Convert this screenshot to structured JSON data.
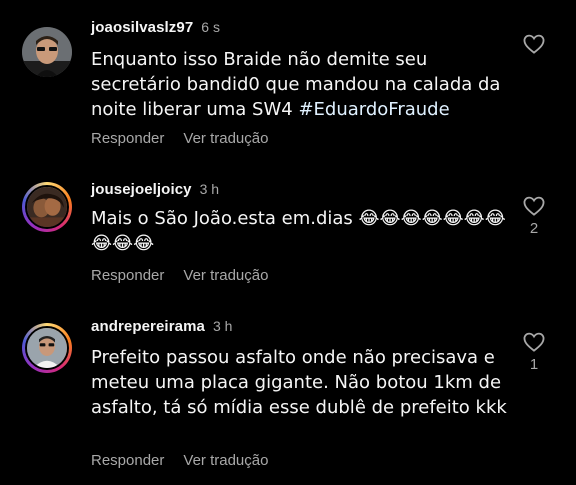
{
  "actions": {
    "reply_label": "Responder",
    "translate_label": "Ver tradução"
  },
  "comments": [
    {
      "username": "joaosilvaslz97",
      "time": "6 s",
      "text": "Enquanto isso Braide não demite seu secretário bandid0 que mandou na calada da noite liberar uma SW4",
      "hashtag": "#EduardoFraude",
      "like_count": "",
      "avatar_icon": "user-avatar-photo"
    },
    {
      "username": "jousejoeljoicy",
      "time": "3 h",
      "text": "Mais o São João.esta em.dias 😂😂😂😂😂😂😂😂😂😂",
      "hashtag": "",
      "like_count": "2",
      "avatar_icon": "user-avatar-photo-story-ring"
    },
    {
      "username": "andrepereirama",
      "time": "3 h",
      "text": "Prefeito passou asfalto onde não precisava e meteu uma placa gigante. Não botou 1km de asfalto, tá só mídia esse dublê de prefeito kkk",
      "hashtag": "",
      "like_count": "1",
      "avatar_icon": "user-avatar-photo-story-ring"
    }
  ],
  "colors": {
    "background": "#000000",
    "text": "#f5f5f5",
    "muted": "#a8a8a8",
    "hashtag": "#e0f1ff"
  }
}
